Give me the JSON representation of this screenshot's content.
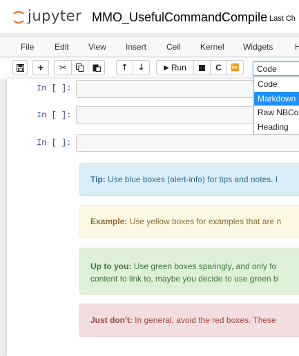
{
  "header": {
    "logo_text": "jupyter",
    "notebook_title": "MMO_UsefulCommandCompile",
    "checkpoint_text": "Last Ch"
  },
  "menu": [
    "File",
    "Edit",
    "View",
    "Insert",
    "Cell",
    "Kernel",
    "Widgets",
    "H"
  ],
  "toolbar": {
    "run_label": "Run",
    "cell_type_value": "Code",
    "cell_type_options": [
      "Code",
      "Markdown",
      "Raw NBCon",
      "Heading"
    ],
    "selected_option_index": 1
  },
  "cells": [
    {
      "prompt": "In [ ]:"
    },
    {
      "prompt": "In [ ]:"
    },
    {
      "prompt": "In [ ]:"
    }
  ],
  "alerts": [
    {
      "style": "info",
      "bold": "Tip:",
      "text": " Use blue boxes (alert-info) for tips and notes. I",
      "line2": ""
    },
    {
      "style": "warning",
      "bold": "Example:",
      "text": " Use yellow boxes for examples that are n",
      "line2": ""
    },
    {
      "style": "success",
      "bold": "Up to you:",
      "text": " Use green boxes sparingly, and only fo",
      "line2": "content to link to, maybe you decide to use green b"
    },
    {
      "style": "danger",
      "bold": "Just don't:",
      "text": " In general, avoid the red boxes. These",
      "line2": ""
    }
  ],
  "colors": {
    "prompt": "#303f9f",
    "dropdown_selected": "#1e90ff",
    "logo_orange": "#f37726"
  }
}
